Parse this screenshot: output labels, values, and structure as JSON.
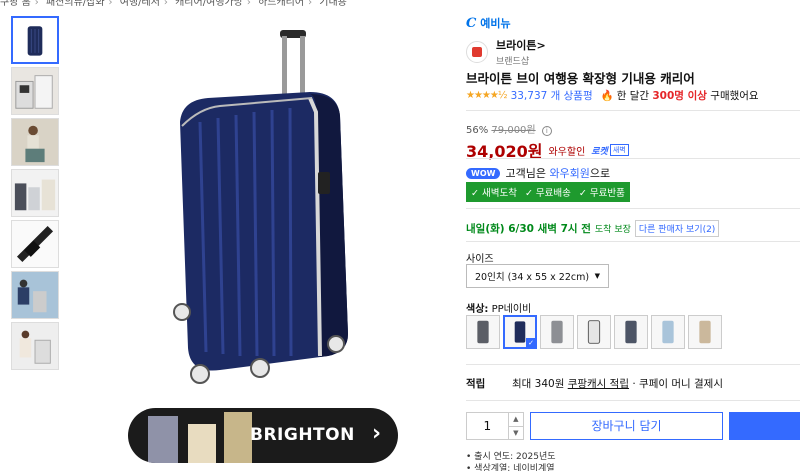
{
  "breadcrumb": [
    "쿠팡 홈",
    "패션의류/잡화",
    "여행/레저",
    "캐리어/여행가방",
    "하드캐리어",
    "기내용"
  ],
  "thumbnails": [
    {
      "name": "front-navy"
    },
    {
      "name": "open-case"
    },
    {
      "name": "model-sitting"
    },
    {
      "name": "set-lineup"
    },
    {
      "name": "handle-detail"
    },
    {
      "name": "model-pair"
    },
    {
      "name": "lifestyle"
    }
  ],
  "banner": {
    "brand": "BRIGHTON",
    "chevron": "›"
  },
  "vendor_tag": {
    "mark": "C",
    "text": "예비뉴"
  },
  "store": {
    "name": "브라이튼",
    "arrow": ">",
    "sub": "브랜드샵"
  },
  "product": {
    "title": "브라이튼 브이 여행용 확장형 기내용 캐리어",
    "stars": "★★★★½",
    "review_count": "33,737 개 상품평",
    "fire_icon": "🔥",
    "purchase_prefix": "한 달간",
    "purchase_count": "300명 이상",
    "purchase_suffix": "구매했어요"
  },
  "price": {
    "discount": "56%",
    "original": "79,000원",
    "info": "i",
    "sale": "34,020원",
    "sale_tag": "와우할인",
    "rocket": "로켓",
    "rocket_sub": "새벽"
  },
  "wow": {
    "badge": "WOW",
    "text_prefix": "고객님은",
    "link": "와우회원",
    "text_suffix": "으로"
  },
  "benefits": [
    "✓ 새벽도착",
    "✓ 무료배송",
    "✓ 무료반품"
  ],
  "delivery": {
    "text": "내일(화) 6/30 새벽 7시 전",
    "small": "도착 보장",
    "other_sellers": "다른 판매자 보기(2)"
  },
  "options": {
    "size_label": "사이즈",
    "size_value": "20인치 (34 x 55 x 22cm)",
    "color_label": "색상:",
    "color_value": "PP네이비"
  },
  "swatch_colors": [
    "#5b5e66",
    "#1f2c5a",
    "#8d8f94",
    "#e5e5e5",
    "#4d5566",
    "#a9c4da",
    "#cbb89c"
  ],
  "points": {
    "label": "적립",
    "prefix": "최대 340원",
    "link": "쿠팡캐시 적립",
    "suffix": "· 쿠페이 머니 결제시"
  },
  "quantity": {
    "value": "1",
    "up": "▲",
    "down": "▼"
  },
  "buttons": {
    "cart": "장바구니 담기"
  },
  "bullets": [
    "출시 연도: 2025년도",
    "색상계열: 네이비계열"
  ],
  "colors": {
    "accent": "#346aff",
    "price": "#ae0000",
    "green": "#1e9a2e"
  }
}
